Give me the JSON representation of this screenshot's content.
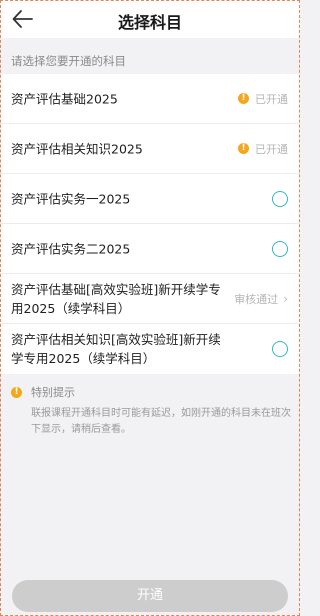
{
  "header": {
    "title": "选择科目",
    "back_icon": "arrow-left-icon"
  },
  "section_hint": "请选择您要开通的科目",
  "subjects": [
    {
      "label": "资产评估基础2025",
      "state": "opened",
      "status_text": "已开通",
      "icon": "warning-icon"
    },
    {
      "label": "资产评估相关知识2025",
      "state": "opened",
      "status_text": "已开通",
      "icon": "warning-icon"
    },
    {
      "label": "资产评估实务一2025",
      "state": "selectable"
    },
    {
      "label": "资产评估实务二2025",
      "state": "selectable"
    },
    {
      "label": "资产评估基础[高效实验班]新开续学专用2025（续学科目）",
      "state": "approved",
      "status_text": "审核通过",
      "icon": "chevron-right-icon"
    },
    {
      "label": "资产评估相关知识[高效实验班]新开续学专用2025（续学科目）",
      "state": "selectable"
    }
  ],
  "notice": {
    "title": "特别提示",
    "text": "联报课程开通科目时可能有延迟，如刚开通的科目未在班次下显示，请稍后查看。"
  },
  "submit_label": "开通",
  "colors": {
    "accent": "#33b6c4",
    "warning": "#f4a71a",
    "disabled_button": "#cdcdcd"
  }
}
